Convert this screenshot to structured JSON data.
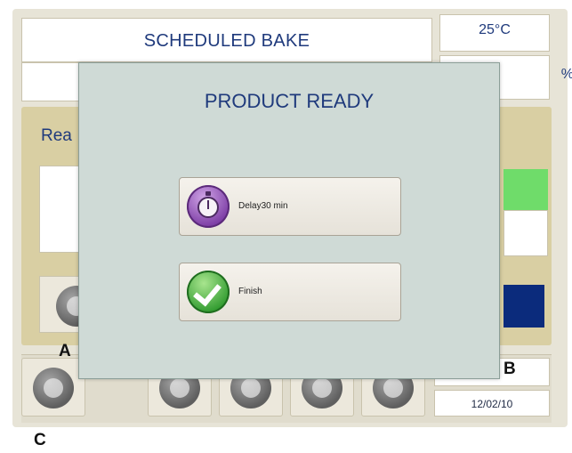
{
  "screen": {
    "title": "SCHEDULED BAKE",
    "temperature": "25°C",
    "humidity": "%",
    "status_partial": "Rea",
    "date": "12/02/10"
  },
  "dialog": {
    "title": "PRODUCT READY",
    "buttons": [
      {
        "label": "Delay30  min",
        "icon": "timer-icon"
      },
      {
        "label": "Finish",
        "icon": "checkmark-icon"
      }
    ]
  },
  "callouts": {
    "a": "A",
    "b": "B",
    "c": "C"
  },
  "colors": {
    "accent_text": "#1f3a7c",
    "indicator_green": "#6fdc6a",
    "indicator_navy": "#0b2b7c",
    "panel_tan": "#d9cfa3",
    "dialog_bg": "#cfdad6"
  }
}
